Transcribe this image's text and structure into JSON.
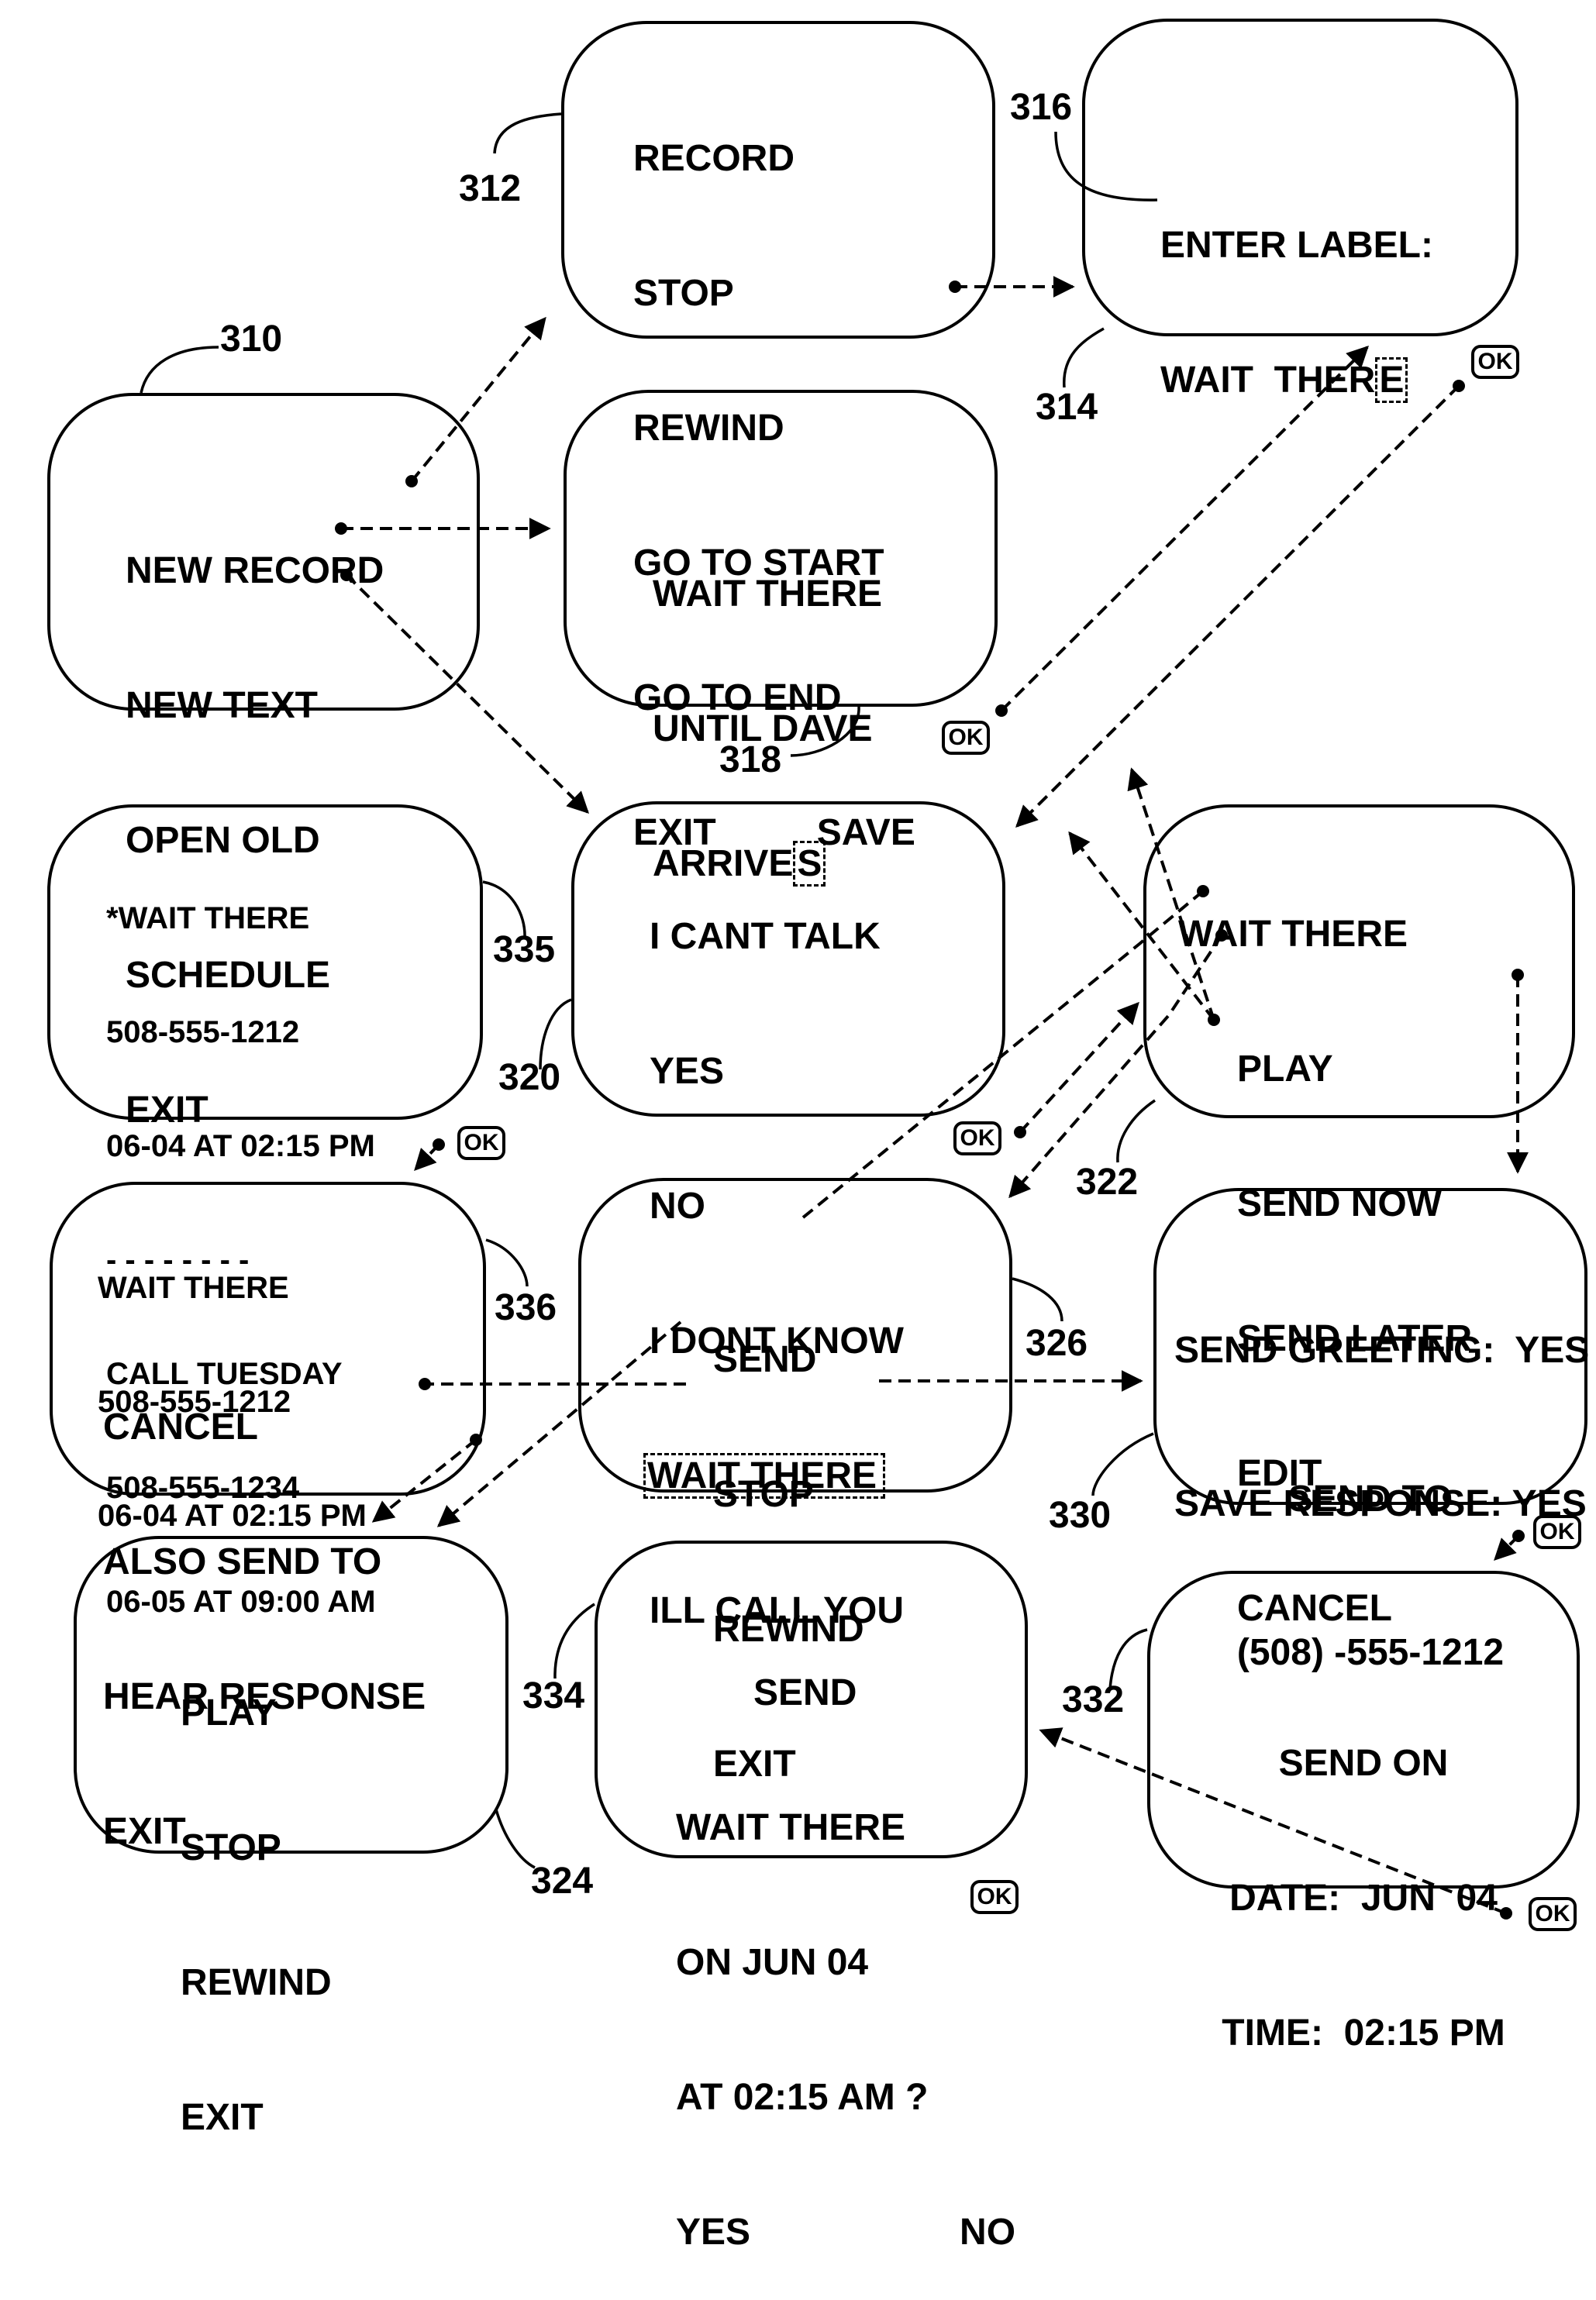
{
  "figure": {
    "screens": {
      "s310": {
        "ref": "310",
        "lines": [
          "NEW RECORD",
          "NEW TEXT",
          "OPEN OLD",
          "SCHEDULE",
          "EXIT"
        ]
      },
      "s312": {
        "ref": "312",
        "lines": [
          "RECORD",
          "STOP",
          "REWIND",
          "GO TO START",
          "GO TO END"
        ],
        "last_left": "EXIT",
        "last_right": "SAVE"
      },
      "s314": {
        "ref": "314",
        "title": "ENTER LABEL:",
        "label_value": "WAIT  THER",
        "cursor_char": "E",
        "label_ref": "316"
      },
      "s318": {
        "ref": "318",
        "lines": [
          "WAIT THERE",
          "UNTIL DAVE"
        ],
        "last_text": "ARRIVE",
        "cursor_char": "S"
      },
      "s335": {
        "ref": "335",
        "lines": [
          "*WAIT THERE",
          "508-555-1212",
          "06-04 AT 02:15 PM",
          "- - - - - - - -",
          "CALL TUESDAY",
          "508-555-1234",
          "06-05 AT 09:00 AM"
        ]
      },
      "s320": {
        "ref": "320",
        "lines": [
          "I CANT TALK",
          "YES",
          "NO",
          "I DONT KNOW"
        ],
        "selected": "WAIT THERE",
        "after": "ILL CALL YOU"
      },
      "s322": {
        "ref": "322",
        "title": "WAIT THERE",
        "lines": [
          "PLAY",
          "SEND NOW",
          "SEND LATER",
          "EDIT",
          "CANCEL"
        ]
      },
      "s336": {
        "ref": "336",
        "info": [
          "WAIT THERE",
          "508-555-1212",
          "06-04 AT 02:15 PM"
        ],
        "lines": [
          "CANCEL",
          "ALSO SEND TO",
          "HEAR RESPONSE",
          "EXIT"
        ]
      },
      "s326": {
        "ref": "326",
        "lines": [
          "SEND",
          "STOP",
          "REWIND",
          "EXIT"
        ]
      },
      "s330": {
        "ref": "330",
        "lines": [
          "SEND GREETING:  YES",
          "SAVE RESPONSE: YES"
        ],
        "send_to_label": "SEND TO",
        "send_to_number": "(508) -555-1212"
      },
      "s324": {
        "ref": "324",
        "lines": [
          "PLAY",
          "STOP",
          "REWIND",
          "EXIT"
        ]
      },
      "s334": {
        "ref": "334",
        "lines": [
          "SEND",
          "WAIT THERE",
          "ON JUN 04",
          "AT 02:15 AM ?"
        ],
        "yes": "YES",
        "no": "NO"
      },
      "s332": {
        "ref": "332",
        "lines": [
          "SEND ON",
          "DATE:  JUN  04",
          "TIME:  02:15 PM"
        ]
      }
    },
    "ok_label": "OK"
  }
}
